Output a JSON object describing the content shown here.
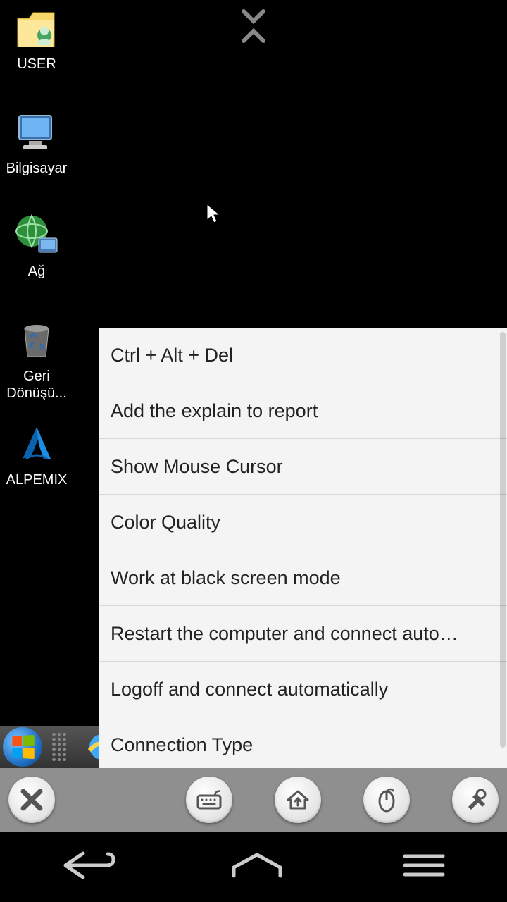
{
  "desktop_icons": {
    "user": "USER",
    "computer": "Bilgisayar",
    "network": "Ağ",
    "recycle": "Geri Dönüşü...",
    "alpemix": "ALPEMIX"
  },
  "menu": {
    "items": [
      "Ctrl + Alt + Del",
      "Add the explain to report",
      "Show Mouse Cursor",
      "Color Quality",
      "Work at black screen mode",
      "Restart the computer and connect auto…",
      "Logoff and connect automatically",
      "Connection Type"
    ]
  }
}
